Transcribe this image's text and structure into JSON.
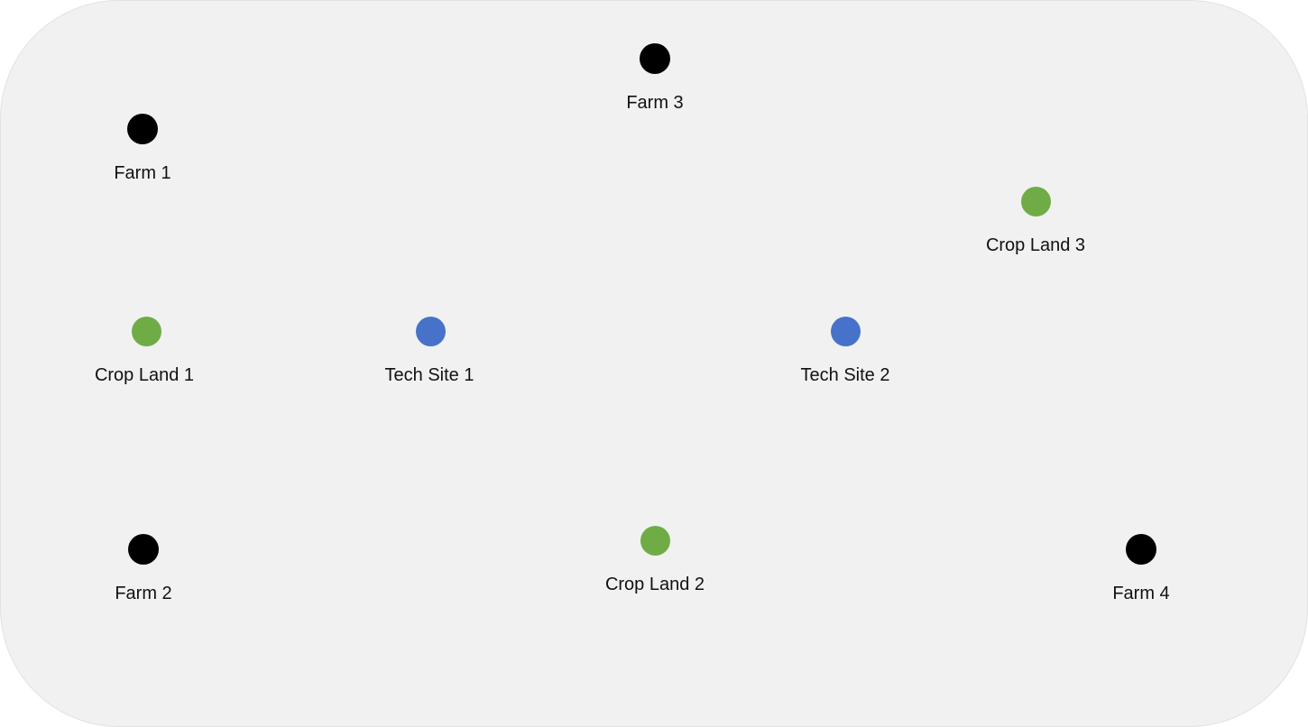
{
  "nodes": {
    "farm_1": {
      "label": "Farm 1",
      "kind": "farm",
      "color": "#000000"
    },
    "farm_2": {
      "label": "Farm 2",
      "kind": "farm",
      "color": "#000000"
    },
    "farm_3": {
      "label": "Farm 3",
      "kind": "farm",
      "color": "#000000"
    },
    "farm_4": {
      "label": "Farm 4",
      "kind": "farm",
      "color": "#000000"
    },
    "crop_land_1": {
      "label": "Crop Land 1",
      "kind": "crop",
      "color": "#6fac46"
    },
    "crop_land_2": {
      "label": "Crop Land 2",
      "kind": "crop",
      "color": "#6fac46"
    },
    "crop_land_3": {
      "label": "Crop Land 3",
      "kind": "crop",
      "color": "#6fac46"
    },
    "tech_site_1": {
      "label": "Tech Site 1",
      "kind": "tech",
      "color": "#4673c9"
    },
    "tech_site_2": {
      "label": "Tech Site 2",
      "kind": "tech",
      "color": "#4673c9"
    }
  }
}
